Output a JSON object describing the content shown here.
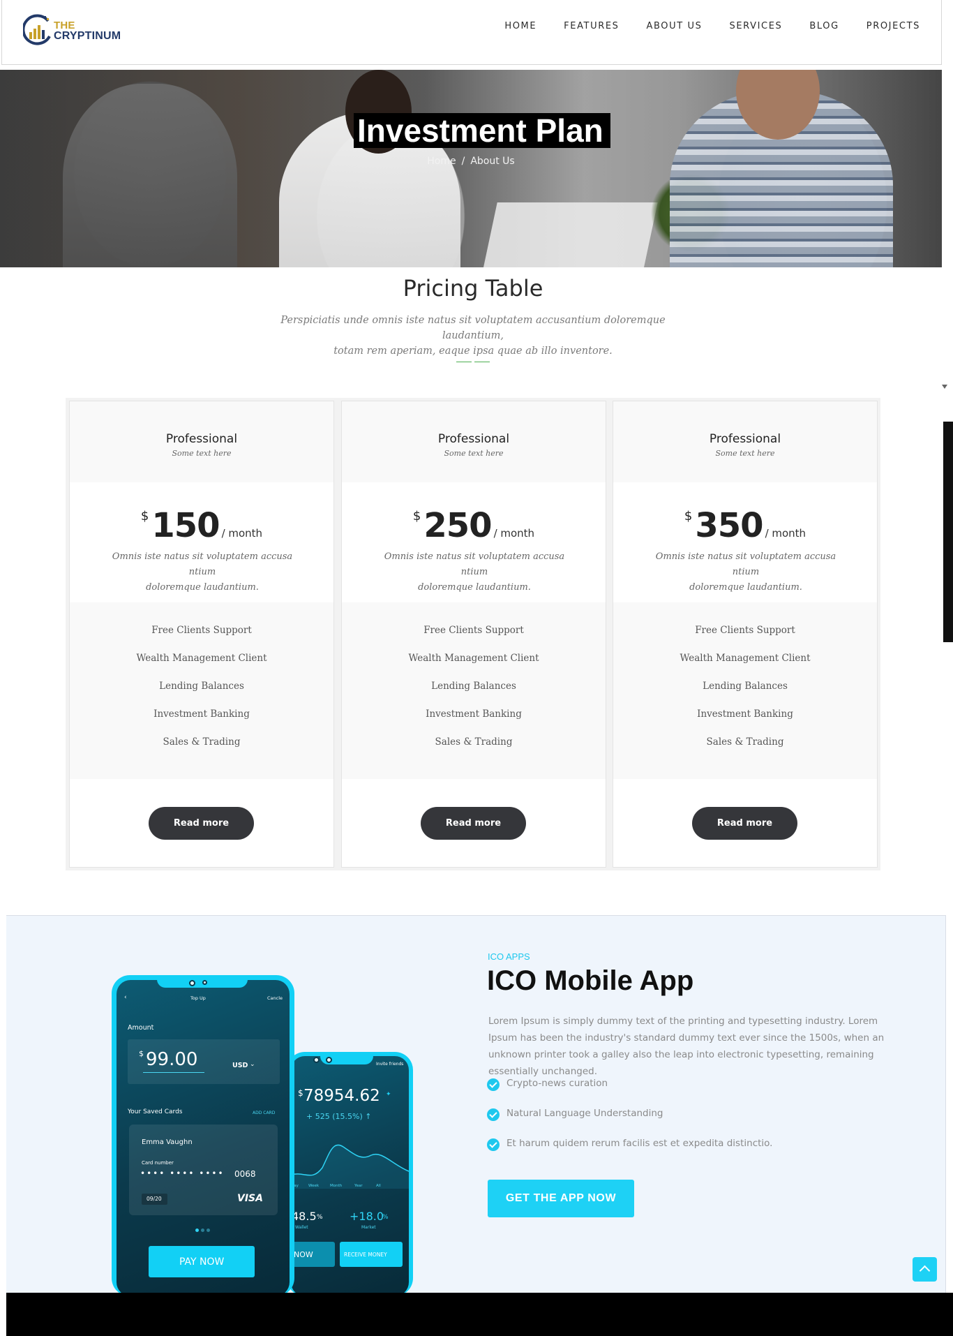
{
  "header": {
    "logo_line1": "THE",
    "logo_line2": "CRYPTINUM",
    "nav": [
      "HOME",
      "FEATURES",
      "ABOUT US",
      "SERVICES",
      "BLOG",
      "PROJECTS"
    ]
  },
  "hero": {
    "title": "Investment Plan",
    "breadcrumb_home": "Home",
    "breadcrumb_sep": "/",
    "breadcrumb_current": "About Us"
  },
  "pricing": {
    "title": "Pricing Table",
    "subtitle_line1": "Perspiciatis unde omnis iste natus sit voluptatem accusantium doloremque laudantium,",
    "subtitle_line2": "totam rem aperiam, eaque ipsa quae ab illo inventore.",
    "cards": [
      {
        "title": "Professional",
        "subtitle": "Some text here",
        "currency": "$",
        "price": "150",
        "period": "/ month",
        "desc_line1": "Omnis iste natus sit voluptatem accusa ntium",
        "desc_line2": "doloremque laudantium.",
        "features": [
          "Free Clients Support",
          "Wealth Management Client",
          "Lending Balances",
          "Investment Banking",
          "Sales & Trading"
        ],
        "button": "Read more"
      },
      {
        "title": "Professional",
        "subtitle": "Some text here",
        "currency": "$",
        "price": "250",
        "period": "/ month",
        "desc_line1": "Omnis iste natus sit voluptatem accusa ntium",
        "desc_line2": "doloremque laudantium.",
        "features": [
          "Free Clients Support",
          "Wealth Management Client",
          "Lending Balances",
          "Investment Banking",
          "Sales & Trading"
        ],
        "button": "Read more"
      },
      {
        "title": "Professional",
        "subtitle": "Some text here",
        "currency": "$",
        "price": "350",
        "period": "/ month",
        "desc_line1": "Omnis iste natus sit voluptatem accusa ntium",
        "desc_line2": "doloremque laudantium.",
        "features": [
          "Free Clients Support",
          "Wealth Management Client",
          "Lending Balances",
          "Investment Banking",
          "Sales & Trading"
        ],
        "button": "Read more"
      }
    ]
  },
  "app": {
    "eyebrow": "ICO APPS",
    "title": "ICO Mobile App",
    "description": "Lorem Ipsum is simply dummy text of the printing and typesetting industry. Lorem Ipsum has been the industry's standard dummy text ever since the 1500s, when an unknown printer took a galley also the leap into electronic typesetting, remaining essentially unchanged.",
    "features": [
      "Crypto-news curation",
      "Natural Language Understanding",
      "Et harum quidem rerum facilis est et expedita distinctio."
    ],
    "button": "GET THE APP NOW",
    "phone1": {
      "top_title": "Top Up",
      "cancel": "Cancle",
      "amount_label": "Amount",
      "currency": "$",
      "amount": "99.00",
      "currency_code": "USD",
      "saved_cards": "Your Saved Cards",
      "add_card": "ADD CARD",
      "card_holder": "Emma Vaughn",
      "card_number_label": "Card number",
      "card_dots": "•••• •••• ••••",
      "card_last4": "0068",
      "card_expiry": "09/20",
      "card_brand": "VISA",
      "pay_button": "PAY NOW"
    },
    "phone2": {
      "invite": "Invite friends",
      "currency": "$",
      "balance": "78954.62",
      "change": "+ 525 (15.5%) ↑",
      "periods": [
        "Day",
        "Week",
        "Month",
        "Year",
        "All"
      ],
      "wallet_value": "48.5",
      "wallet_unit": "%",
      "wallet_label": "Wallet",
      "market_value": "+18.0",
      "market_unit": "%",
      "market_label": "Market",
      "send_button": "NOW",
      "receive_button": "RECEIVE MONEY"
    }
  },
  "colors": {
    "accent": "#1ed1f5",
    "dark_button": "#35363a",
    "divider": "#4caf50",
    "logo_gold": "#c8a12a",
    "logo_navy": "#233a69"
  }
}
